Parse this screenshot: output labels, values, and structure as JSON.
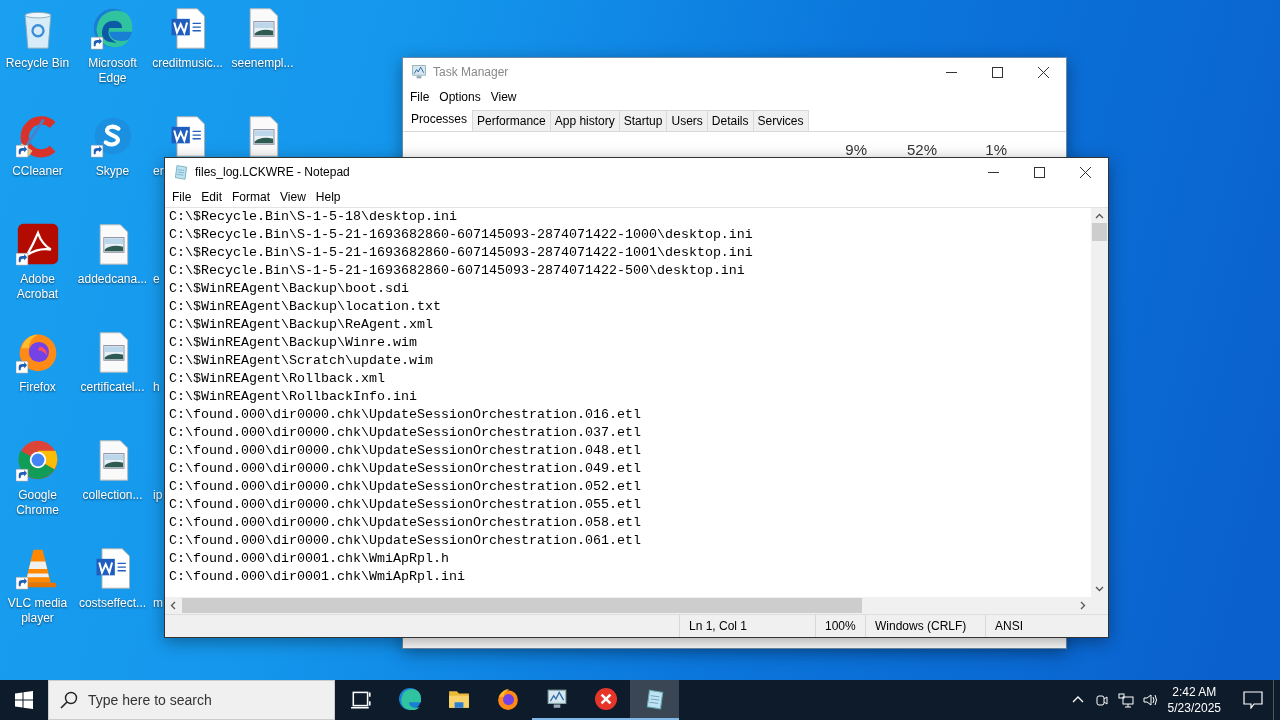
{
  "desktop": {
    "icons": [
      {
        "label": "Recycle Bin",
        "kind": "recycle",
        "shortcut": false,
        "label_cut": false
      },
      {
        "label": "CCleaner",
        "kind": "ccleaner",
        "shortcut": true,
        "label_cut": false
      },
      {
        "label": "Adobe Acrobat",
        "kind": "acrobat",
        "shortcut": true,
        "label_cut": false
      },
      {
        "label": "Firefox",
        "kind": "firefox",
        "shortcut": true,
        "label_cut": false
      },
      {
        "label": "Google Chrome",
        "kind": "chrome",
        "shortcut": true,
        "label_cut": false
      },
      {
        "label": "VLC media player",
        "kind": "vlc",
        "shortcut": true,
        "label_cut": false
      },
      {
        "label": "Microsoft Edge",
        "kind": "edge",
        "shortcut": true,
        "label_cut": false
      },
      {
        "label": "Skype",
        "kind": "skype",
        "shortcut": true,
        "label_cut": false
      },
      {
        "label": "addedcana...",
        "kind": "image",
        "shortcut": false,
        "label_cut": false
      },
      {
        "label": "certificatel...",
        "kind": "image",
        "shortcut": false,
        "label_cut": false
      },
      {
        "label": "collection...",
        "kind": "image",
        "shortcut": false,
        "label_cut": false
      },
      {
        "label": "costseffect...",
        "kind": "word",
        "shortcut": false,
        "label_cut": false
      },
      {
        "label": "creditmusic...",
        "kind": "word",
        "shortcut": false,
        "label_cut": false
      },
      {
        "label": "er",
        "kind": "word",
        "shortcut": false,
        "label_cut": true
      },
      {
        "label": "e",
        "kind": "blank",
        "label_cut": true
      },
      {
        "label": "h",
        "kind": "blank",
        "label_cut": true
      },
      {
        "label": "ip",
        "kind": "blank",
        "label_cut": true
      },
      {
        "label": "m",
        "kind": "blank",
        "label_cut": true
      },
      {
        "label": "seenempl...",
        "kind": "image",
        "shortcut": false,
        "label_cut": false
      },
      {
        "kind": "image",
        "shortcut": false
      }
    ]
  },
  "task_manager": {
    "title": "Task Manager",
    "menu": [
      "File",
      "Options",
      "View"
    ],
    "tabs": [
      {
        "label": "Processes",
        "selected": true
      },
      {
        "label": "Performance",
        "selected": false
      },
      {
        "label": "App history",
        "selected": false
      },
      {
        "label": "Startup",
        "selected": false
      },
      {
        "label": "Users",
        "selected": false
      },
      {
        "label": "Details",
        "selected": false
      },
      {
        "label": "Services",
        "selected": false
      }
    ],
    "column_headers": [
      "9%",
      "52%",
      "1%"
    ]
  },
  "notepad": {
    "title": "files_log.LCKWRE - Notepad",
    "menu": [
      "File",
      "Edit",
      "Format",
      "View",
      "Help"
    ],
    "lines": [
      "C:\\$Recycle.Bin\\S-1-5-18\\desktop.ini",
      "C:\\$Recycle.Bin\\S-1-5-21-1693682860-607145093-2874071422-1000\\desktop.ini",
      "C:\\$Recycle.Bin\\S-1-5-21-1693682860-607145093-2874071422-1001\\desktop.ini",
      "C:\\$Recycle.Bin\\S-1-5-21-1693682860-607145093-2874071422-500\\desktop.ini",
      "C:\\$WinREAgent\\Backup\\boot.sdi",
      "C:\\$WinREAgent\\Backup\\location.txt",
      "C:\\$WinREAgent\\Backup\\ReAgent.xml",
      "C:\\$WinREAgent\\Backup\\Winre.wim",
      "C:\\$WinREAgent\\Scratch\\update.wim",
      "C:\\$WinREAgent\\Rollback.xml",
      "C:\\$WinREAgent\\RollbackInfo.ini",
      "C:\\found.000\\dir0000.chk\\UpdateSessionOrchestration.016.etl",
      "C:\\found.000\\dir0000.chk\\UpdateSessionOrchestration.037.etl",
      "C:\\found.000\\dir0000.chk\\UpdateSessionOrchestration.048.etl",
      "C:\\found.000\\dir0000.chk\\UpdateSessionOrchestration.049.etl",
      "C:\\found.000\\dir0000.chk\\UpdateSessionOrchestration.052.etl",
      "C:\\found.000\\dir0000.chk\\UpdateSessionOrchestration.055.etl",
      "C:\\found.000\\dir0000.chk\\UpdateSessionOrchestration.058.etl",
      "C:\\found.000\\dir0000.chk\\UpdateSessionOrchestration.061.etl",
      "C:\\found.000\\dir0001.chk\\WmiApRpl.h",
      "C:\\found.000\\dir0001.chk\\WmiApRpl.ini"
    ],
    "status_bar": [
      "Ln 1, Col 1",
      "100%",
      "Windows (CRLF)",
      "ANSI"
    ]
  },
  "taskbar": {
    "search": {
      "placeholder": "Type here to search"
    },
    "apps": [
      {
        "kind": "taskview",
        "running": false,
        "selected": false
      },
      {
        "kind": "edge",
        "running": false,
        "selected": false
      },
      {
        "kind": "folder",
        "running": false,
        "selected": false
      },
      {
        "kind": "firefox",
        "running": false,
        "selected": false
      },
      {
        "kind": "monitor",
        "running": true,
        "selected": false
      },
      {
        "kind": "error",
        "running": true,
        "selected": false
      },
      {
        "kind": "notepad",
        "running": true,
        "selected": true
      }
    ],
    "time": "2:42 AM",
    "date": "5/23/2025"
  }
}
